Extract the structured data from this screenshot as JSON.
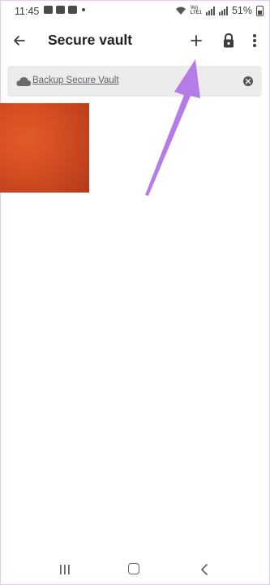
{
  "status_bar": {
    "time": "11:45",
    "battery_percent": "51%",
    "network_label_top": "Vo)",
    "network_label_bottom": "LTE1",
    "icons": [
      "chat-icon",
      "chat-icon",
      "message-icon",
      "dot-icon",
      "wifi-icon",
      "signal-icon",
      "battery-icon"
    ]
  },
  "app_bar": {
    "title": "Secure vault",
    "icons": [
      "back-arrow-icon",
      "add-icon",
      "lock-icon",
      "more-vert-icon"
    ]
  },
  "banner": {
    "label": "Backup Secure Vault",
    "icons": [
      "cloud-icon",
      "close-circle-icon"
    ]
  },
  "content": {
    "thumbnail_color": "#d34c22"
  },
  "annotation": {
    "arrow_color": "#b57be6"
  },
  "nav_bar": {
    "icons": [
      "recent-apps-icon",
      "home-icon",
      "back-icon"
    ]
  },
  "colors": {
    "background": "#ffffff",
    "banner_bg": "#ececec",
    "title_text": "#202124",
    "secondary_text": "#5f6368"
  }
}
